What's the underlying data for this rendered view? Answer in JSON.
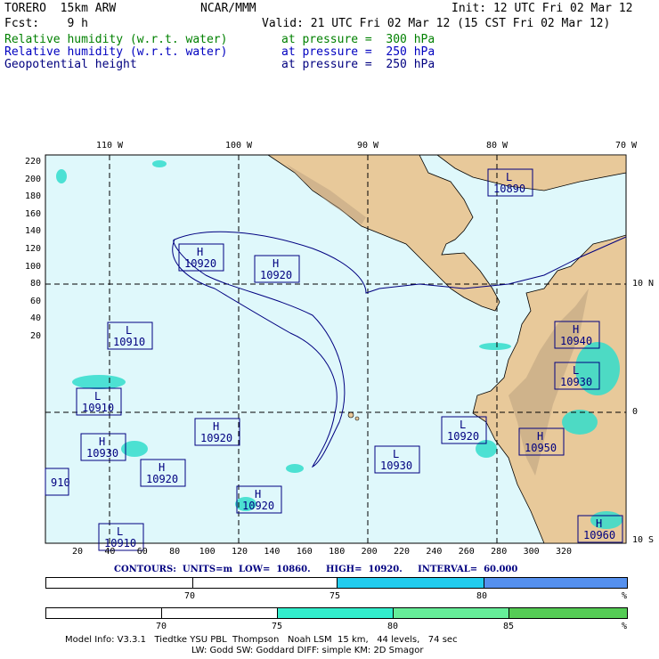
{
  "header": {
    "model": "TORERO  15km ARW",
    "org": "NCAR/MMM",
    "init": "Init: 12 UTC Fri 02 Mar 12",
    "fcst": "Fcst:    9 h",
    "valid": "Valid: 21 UTC Fri 02 Mar 12 (15 CST Fri 02 Mar 12)",
    "fields": [
      {
        "name": "Relative humidity (w.r.t. water)",
        "level": "at pressure =  300 hPa",
        "color": "#008000"
      },
      {
        "name": "Relative humidity (w.r.t. water)",
        "level": "at pressure =  250 hPa",
        "color": "#0000c0"
      },
      {
        "name": "Geopotential height",
        "level": "at pressure =  250 hPa",
        "color": "#000080"
      }
    ]
  },
  "map": {
    "top_lon_labels": [
      "110 W",
      "100 W",
      "90 W",
      "80 W",
      "70 W"
    ],
    "right_lat_labels": [
      "10 N",
      "0",
      "10 S"
    ],
    "left_y_ticks": [
      "220",
      "200",
      "180",
      "160",
      "140",
      "120",
      "100",
      "80",
      "60",
      "40",
      "20"
    ],
    "bottom_x_ticks": [
      "20",
      "40",
      "60",
      "80",
      "100",
      "120",
      "140",
      "160",
      "180",
      "200",
      "220",
      "240",
      "260",
      "280",
      "300",
      "320"
    ],
    "ocean_color": "#dff8fb",
    "land_color": "#e8c99a",
    "highlow_labels": [
      {
        "type": "L",
        "value": "10890"
      },
      {
        "type": "H",
        "value": "10920"
      },
      {
        "type": "H",
        "value": "10920"
      },
      {
        "type": "L",
        "value": "10910"
      },
      {
        "type": "H",
        "value": "10940"
      },
      {
        "type": "L",
        "value": "10930"
      },
      {
        "type": "L",
        "value": "10910"
      },
      {
        "type": "L",
        "value": "10920"
      },
      {
        "type": "H",
        "value": "10920"
      },
      {
        "type": "H",
        "value": "10930"
      },
      {
        "type": "H",
        "value": "10950"
      },
      {
        "type": "H",
        "value": "10920"
      },
      {
        "type": "L",
        "value": "10930"
      },
      {
        "type": "H",
        "value": "10920"
      },
      {
        "type": "H",
        "value": "10960"
      },
      {
        "type": "L",
        "value": "10910"
      },
      {
        "type": "",
        "value": "910"
      }
    ]
  },
  "contour_info": "CONTOURS:  UNITS=m  LOW=  10860.     HIGH=  10920.     INTERVAL=  60.000",
  "colorbar1": {
    "labels": [
      "70",
      "75",
      "80"
    ],
    "unit": "%",
    "colors": [
      "#ffffff",
      "#ffffff",
      "#22ccee",
      "#5590ee"
    ]
  },
  "colorbar2": {
    "labels": [
      "70",
      "75",
      "80",
      "85"
    ],
    "unit": "%",
    "colors": [
      "#ffffff",
      "#ffffff",
      "#33eecc",
      "#66ee99",
      "#55cc55"
    ]
  },
  "footer": {
    "line1": "Model Info: V3.3.1   Tiedtke YSU PBL  Thompson   Noah LSM  15 km,   44 levels,   74 sec",
    "line2": "LW: Godd SW: Goddard DIFF: simple KM: 2D Smagor"
  }
}
